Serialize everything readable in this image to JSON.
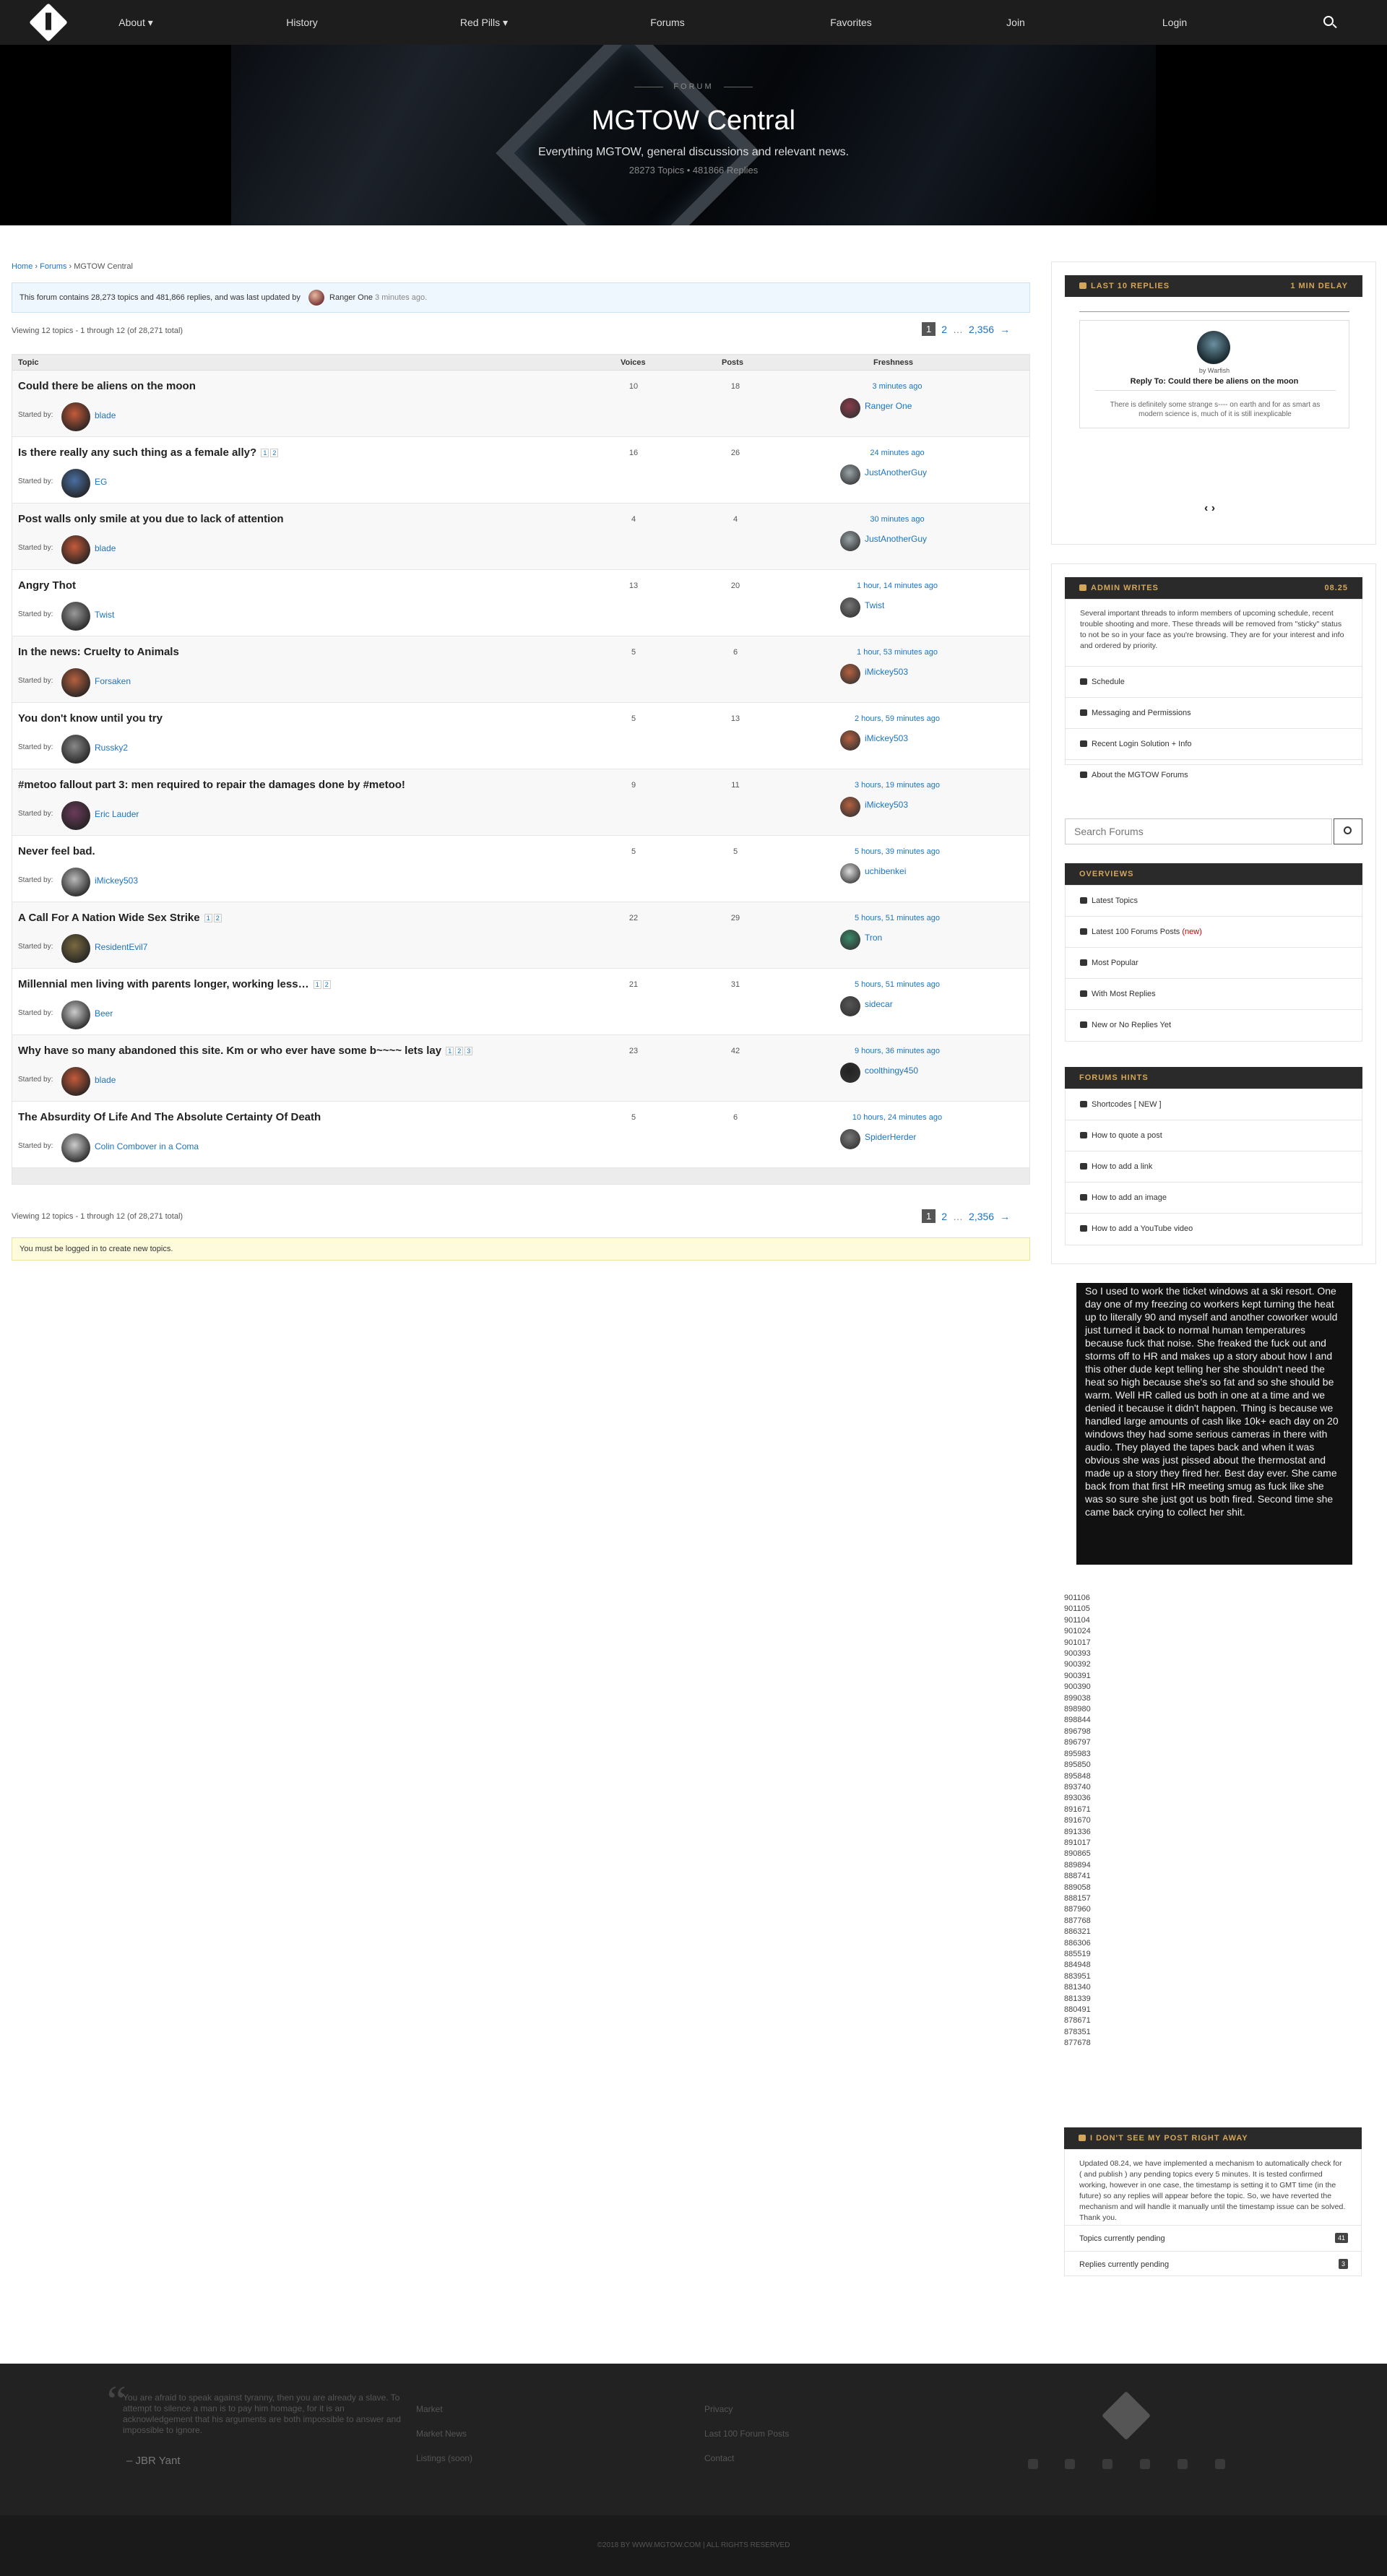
{
  "nav": {
    "about": "About ▾",
    "history": "History",
    "red_pills": "Red Pills ▾",
    "forums": "Forums",
    "favorites": "Favorites",
    "join": "Join",
    "login": "Login"
  },
  "hero": {
    "label": "FORUM",
    "title": "MGTOW Central",
    "subtitle": "Everything MGTOW, general discussions and relevant news.",
    "stats": "28273 Topics • 481866 Replies"
  },
  "breadcrumb": {
    "home": "Home",
    "forums": "Forums",
    "current": "MGTOW Central"
  },
  "notice": {
    "text": "This forum contains 28,273 topics and 481,866 replies, and was last updated by",
    "user": "Ranger One",
    "time": "3 minutes ago."
  },
  "viewing": "Viewing 12 topics - 1 through 12 (of 28,271 total)",
  "pagination": {
    "current": "1",
    "next_page": "2",
    "dots": "…",
    "last": "2,356",
    "arrow": "→"
  },
  "table_headers": {
    "topic": "Topic",
    "voices": "Voices",
    "posts": "Posts",
    "freshness": "Freshness"
  },
  "started_by_label": "Started by:",
  "topics": [
    {
      "title": "Could there be aliens on the moon",
      "pages": [],
      "author": "blade",
      "voices": "10",
      "posts": "18",
      "freshness": "3 minutes ago",
      "last_user": "Ranger One"
    },
    {
      "title": "Is there really any such thing as a female ally?",
      "pages": [
        "1",
        "2"
      ],
      "author": "EG",
      "voices": "16",
      "posts": "26",
      "freshness": "24 minutes ago",
      "last_user": "JustAnotherGuy"
    },
    {
      "title": "Post walls only smile at you due to lack of attention",
      "pages": [],
      "author": "blade",
      "voices": "4",
      "posts": "4",
      "freshness": "30 minutes ago",
      "last_user": "JustAnotherGuy"
    },
    {
      "title": "Angry Thot",
      "pages": [],
      "author": "Twist",
      "voices": "13",
      "posts": "20",
      "freshness": "1 hour, 14 minutes ago",
      "last_user": "Twist"
    },
    {
      "title": "In the news: Cruelty to Animals",
      "pages": [],
      "author": "Forsaken",
      "voices": "5",
      "posts": "6",
      "freshness": "1 hour, 53 minutes ago",
      "last_user": "iMickey503"
    },
    {
      "title": "You don't know until you try",
      "pages": [],
      "author": "Russky2",
      "voices": "5",
      "posts": "13",
      "freshness": "2 hours, 59 minutes ago",
      "last_user": "iMickey503"
    },
    {
      "title": "#metoo fallout part 3: men required to repair the damages done by #metoo!",
      "pages": [],
      "author": "Eric Lauder",
      "voices": "9",
      "posts": "11",
      "freshness": "3 hours, 19 minutes ago",
      "last_user": "iMickey503"
    },
    {
      "title": "Never feel bad.",
      "pages": [],
      "author": "iMickey503",
      "voices": "5",
      "posts": "5",
      "freshness": "5 hours, 39 minutes ago",
      "last_user": "uchibenkei"
    },
    {
      "title": "A Call For A Nation Wide Sex Strike",
      "pages": [
        "1",
        "2"
      ],
      "author": "ResidentEvil7",
      "voices": "22",
      "posts": "29",
      "freshness": "5 hours, 51 minutes ago",
      "last_user": "Tron"
    },
    {
      "title": "Millennial men living with parents longer, working less…",
      "pages": [
        "1",
        "2"
      ],
      "author": "Beer",
      "voices": "21",
      "posts": "31",
      "freshness": "5 hours, 51 minutes ago",
      "last_user": "sidecar"
    },
    {
      "title": "Why have so many abandoned this site. Km or who ever have some b~~~~ lets lay",
      "pages": [
        "1",
        "2",
        "3"
      ],
      "author": "blade",
      "voices": "23",
      "posts": "42",
      "freshness": "9 hours, 36 minutes ago",
      "last_user": "coolthingy450"
    },
    {
      "title": "The Absurdity Of Life And The Absolute Certainty Of Death",
      "pages": [],
      "author": "Colin Combover in a Coma",
      "voices": "5",
      "posts": "6",
      "freshness": "10 hours, 24 minutes ago",
      "last_user": "SpiderHerder"
    }
  ],
  "login_notice": "You must be logged in to create new topics.",
  "sidebar": {
    "last_replies": {
      "title": "LAST 10 REPLIES",
      "delay": "1 MIN DELAY",
      "by": "by Warfish",
      "reply_to": "Reply To: Could there be aliens on the moon",
      "excerpt": "There is definitely some strange s---- on earth and for as smart as modern science is, much of it is still inexplicable"
    },
    "admin": {
      "title": "ADMIN WRITES",
      "date": "08.25",
      "text": "Several important threads to inform members of upcoming schedule, recent trouble shooting and more. These threads will be removed from \"sticky\" status to not be so in your face as you're browsing. They are for your interest and info and ordered by priority.",
      "links": [
        "Schedule",
        "Messaging and Permissions",
        "Recent Login Solution + Info",
        "About the MGTOW Forums"
      ]
    },
    "search_placeholder": "Search Forums",
    "overviews": {
      "title": "OVERVIEWS",
      "items": [
        "Latest Topics",
        "Latest 100 Forums Posts",
        "Most Popular",
        "With Most Replies",
        "New or No Replies Yet"
      ],
      "new_badge": "(new)"
    },
    "hints": {
      "title": "FORUMS HINTS",
      "items": [
        "Shortcodes [ NEW ]",
        "How to quote a post",
        "How to add a link",
        "How to add an image",
        "How to add a YouTube video"
      ]
    },
    "quote": "So I used to work the ticket windows at a ski resort. One day one of my freezing co workers kept turning the heat up to literally 90 and myself and another coworker would just turned it back to normal human temperatures because fuck that noise. She freaked the fuck out and storms off to HR and makes up a story about how I and this other dude kept telling her she shouldn't need the heat so high because she's so fat and so she should be warm. Well HR called us both in one at a time and we denied it because it didn't happen. Thing is because we handled large amounts of cash like 10k+ each day on 20 windows they had some serious cameras in there with audio. They played the tapes back and when it was obvious she was just pissed about the thermostat and made up a story they fired her. Best day ever. She came back from that first HR meeting smug as fuck like she was so sure she just got us both fired. Second time she came back crying to collect her shit.",
    "ids": [
      "901106",
      "901105",
      "901104",
      "901024",
      "901017",
      "900393",
      "900392",
      "900391",
      "900390",
      "899038",
      "898980",
      "898844",
      "896798",
      "896797",
      "895983",
      "895850",
      "895848",
      "893740",
      "893036",
      "891671",
      "891670",
      "891336",
      "891017",
      "890865",
      "889894",
      "888741",
      "889058",
      "888157",
      "887960",
      "887768",
      "886321",
      "886306",
      "885519",
      "884948",
      "883951",
      "881340",
      "881339",
      "880491",
      "878671",
      "878351",
      "877678"
    ],
    "pending": {
      "title": "I DON'T SEE MY POST RIGHT AWAY",
      "text": "Updated 08.24, we have implemented a mechanism to automatically check for ( and publish ) any pending topics every 5 minutes. It is tested confirmed working, however in one case, the timestamp is setting it to GMT time (in the future) so any replies will appear before the topic. So, we have reverted the mechanism and will handle it manually until the timestamp issue can be solved. Thank you.",
      "topics_label": "Topics currently pending",
      "topics_count": "41",
      "replies_label": "Replies currently pending",
      "replies_count": "3"
    }
  },
  "footer": {
    "quote": "You are afraid to speak against tyranny, then you are already a slave. To attempt to silence a man is to pay him homage, for it is an acknowledgement that his arguments are both impossible to answer and impossible to ignore.",
    "author": "– JBR Yant",
    "links_col1": [
      "Market",
      "Market News",
      "Listings (soon)"
    ],
    "links_col2": [
      "Privacy",
      "Last 100 Forum Posts",
      "Contact"
    ],
    "copyright": "©2018 BY WWW.MGTOW.COM | ALL RIGHTS RESERVED"
  },
  "colors": {
    "accent": "#d4a65a",
    "link": "#1e73be",
    "dark": "#1d1d1d"
  }
}
